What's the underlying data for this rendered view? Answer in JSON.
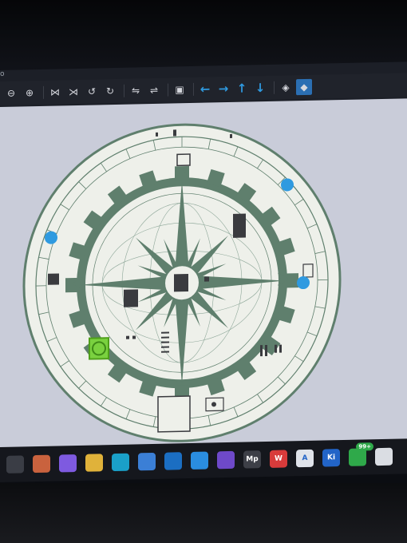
{
  "window": {
    "menu_hint": "o"
  },
  "toolbar": {
    "buttons": [
      {
        "icon": "zoom-fit-icon",
        "glyph": "⊖"
      },
      {
        "icon": "zoom-in-icon",
        "glyph": "⊕"
      },
      {
        "icon": "mirror-x-icon",
        "glyph": "⋈"
      },
      {
        "icon": "mirror-y-icon",
        "glyph": "⋊"
      },
      {
        "icon": "rotate-ccw-icon",
        "glyph": "↺"
      },
      {
        "icon": "rotate-cw-icon",
        "glyph": "↻"
      },
      {
        "icon": "flip-h-icon",
        "glyph": "⇋"
      },
      {
        "icon": "flip-v-icon",
        "glyph": "⇌"
      },
      {
        "icon": "layer-icon",
        "glyph": "▣"
      }
    ],
    "arrows": [
      {
        "icon": "arrow-left-icon",
        "glyph": "←"
      },
      {
        "icon": "arrow-right-icon",
        "glyph": "→"
      },
      {
        "icon": "arrow-up-icon",
        "glyph": "↑"
      },
      {
        "icon": "arrow-down-icon",
        "glyph": "↓"
      }
    ],
    "view3d": [
      {
        "icon": "3d-box-icon",
        "glyph": "◈"
      },
      {
        "icon": "3d-view-active-icon",
        "glyph": "◆"
      }
    ]
  },
  "colors": {
    "board": "#eef0ea",
    "silkscreen": "#5f7f6d",
    "canvas": "#c9ccd9",
    "accent": "#2f9ae0",
    "pad_green": "#7ad13f"
  },
  "taskbar": {
    "apps": [
      {
        "icon": "start-icon",
        "label": "",
        "bg": "#3a3d45"
      },
      {
        "icon": "photos-icon",
        "label": "",
        "bg": "#c9623e"
      },
      {
        "icon": "copilot-icon",
        "label": "",
        "bg": "#7e5ae0"
      },
      {
        "icon": "file-explorer-icon",
        "label": "",
        "bg": "#e0b23a"
      },
      {
        "icon": "edge-icon",
        "label": "",
        "bg": "#1aa0c9"
      },
      {
        "icon": "store-icon",
        "label": "",
        "bg": "#3b7fd6"
      },
      {
        "icon": "outlook-icon",
        "label": "",
        "bg": "#1b6ec2"
      },
      {
        "icon": "vscode-icon",
        "label": "",
        "bg": "#2a8de0"
      },
      {
        "icon": "github-icon",
        "label": "",
        "bg": "#6e49c9"
      },
      {
        "icon": "mp-app-icon",
        "label": "Mp",
        "bg": "#3d3f47"
      },
      {
        "icon": "wps-icon",
        "label": "W",
        "bg": "#d83b3b"
      },
      {
        "icon": "arc-app-icon",
        "label": "A",
        "bg": "#dfe3ea"
      },
      {
        "icon": "kicad-icon",
        "label": "Ki",
        "bg": "#2264c7"
      },
      {
        "icon": "wechat-icon",
        "label": "",
        "bg": "#2fa94a",
        "badge": "99+"
      },
      {
        "icon": "window-app-icon",
        "label": "",
        "bg": "#dadde3"
      }
    ]
  }
}
